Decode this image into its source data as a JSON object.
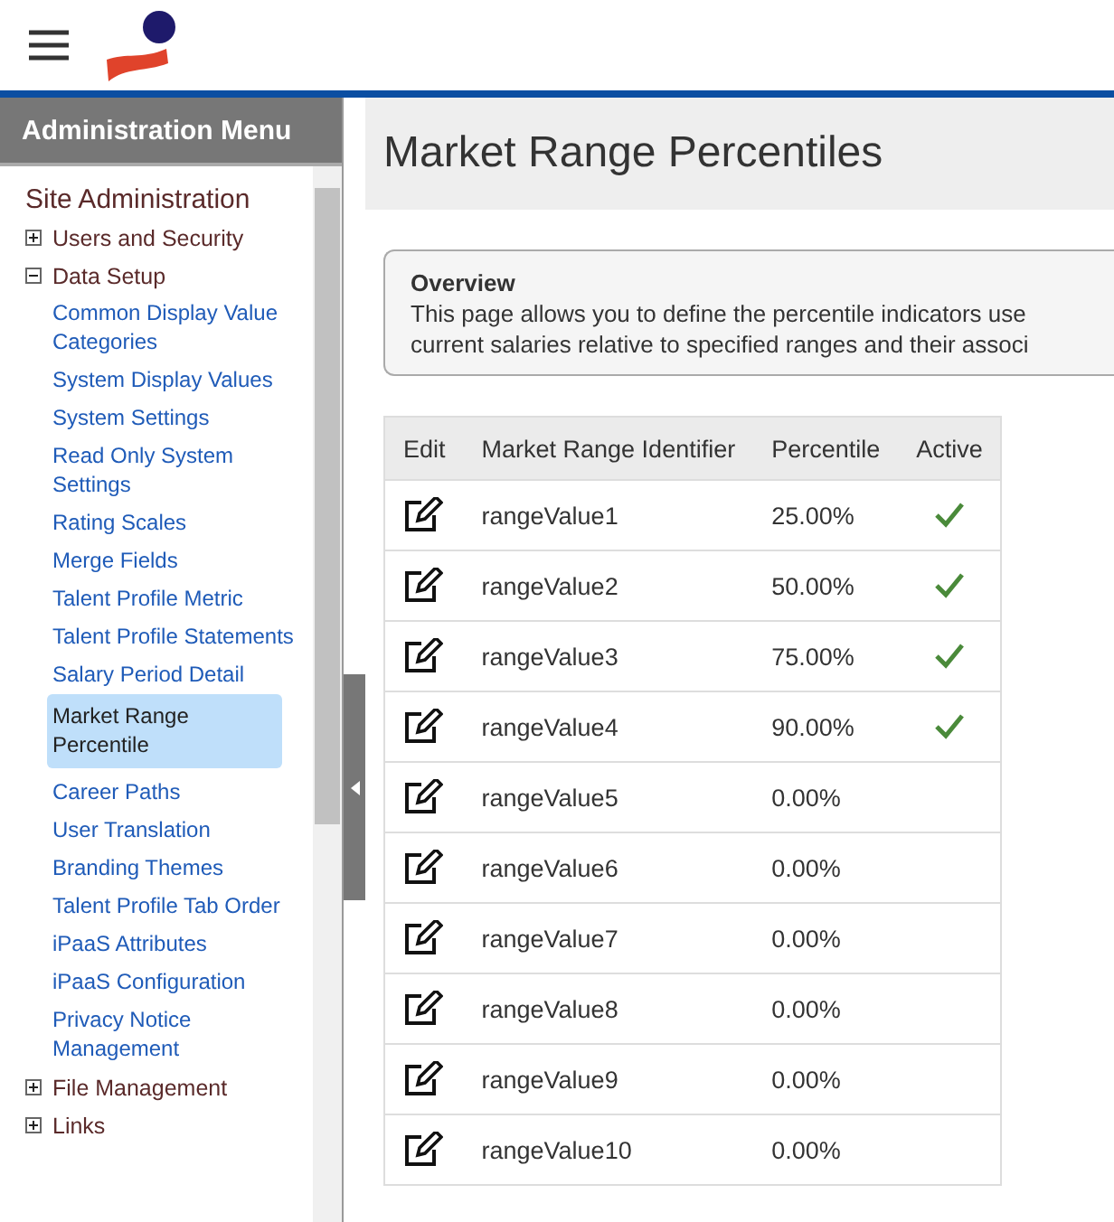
{
  "sidebar": {
    "title": "Administration Menu",
    "section": "Site Administration",
    "items": [
      {
        "label": "Users and Security",
        "expanded": false
      },
      {
        "label": "Data Setup",
        "expanded": true,
        "children": [
          {
            "label": "Common Display Value Categories",
            "selected": false
          },
          {
            "label": "System Display Values",
            "selected": false
          },
          {
            "label": "System Settings",
            "selected": false
          },
          {
            "label": "Read Only System Settings",
            "selected": false
          },
          {
            "label": "Rating Scales",
            "selected": false
          },
          {
            "label": "Merge Fields",
            "selected": false
          },
          {
            "label": "Talent Profile Metric",
            "selected": false
          },
          {
            "label": "Talent Profile Statements",
            "selected": false
          },
          {
            "label": "Salary Period Detail",
            "selected": false
          },
          {
            "label": "Market Range Percentile",
            "selected": true
          },
          {
            "label": "Career Paths",
            "selected": false
          },
          {
            "label": "User Translation",
            "selected": false
          },
          {
            "label": "Branding Themes",
            "selected": false
          },
          {
            "label": "Talent Profile Tab Order",
            "selected": false
          },
          {
            "label": "iPaaS Attributes",
            "selected": false
          },
          {
            "label": "iPaaS Configuration",
            "selected": false
          },
          {
            "label": "Privacy Notice Management",
            "selected": false
          }
        ]
      },
      {
        "label": "File Management",
        "expanded": false
      },
      {
        "label": "Links",
        "expanded": false
      }
    ]
  },
  "page_title": "Market Range Percentiles",
  "overview": {
    "heading": "Overview",
    "lines": [
      "This page allows you to define the percentile indicators use",
      "current salaries relative to specified ranges and their associ"
    ]
  },
  "table": {
    "columns": [
      "Edit",
      "Market Range Identifier",
      "Percentile",
      "Active"
    ],
    "rows": [
      {
        "identifier": "rangeValue1",
        "percentile": "25.00%",
        "active": true
      },
      {
        "identifier": "rangeValue2",
        "percentile": "50.00%",
        "active": true
      },
      {
        "identifier": "rangeValue3",
        "percentile": "75.00%",
        "active": true
      },
      {
        "identifier": "rangeValue4",
        "percentile": "90.00%",
        "active": true
      },
      {
        "identifier": "rangeValue5",
        "percentile": "0.00%",
        "active": false
      },
      {
        "identifier": "rangeValue6",
        "percentile": "0.00%",
        "active": false
      },
      {
        "identifier": "rangeValue7",
        "percentile": "0.00%",
        "active": false
      },
      {
        "identifier": "rangeValue8",
        "percentile": "0.00%",
        "active": false
      },
      {
        "identifier": "rangeValue9",
        "percentile": "0.00%",
        "active": false
      },
      {
        "identifier": "rangeValue10",
        "percentile": "0.00%",
        "active": false
      }
    ]
  }
}
